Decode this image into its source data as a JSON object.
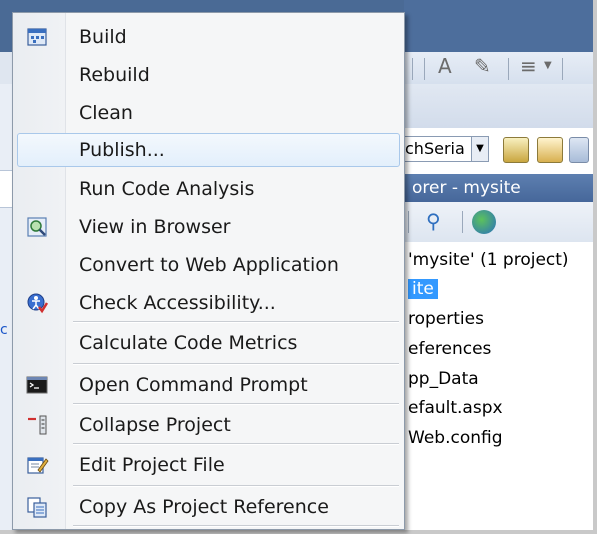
{
  "menu": {
    "items": [
      {
        "label": "Build",
        "icon": "build-icon"
      },
      {
        "label": "Rebuild",
        "icon": ""
      },
      {
        "label": "Clean",
        "icon": ""
      },
      {
        "label": "Publish...",
        "icon": "",
        "highlighted": true
      },
      {
        "label": "Run Code Analysis",
        "icon": ""
      },
      {
        "label": "View in Browser",
        "icon": "view-in-browser-icon"
      },
      {
        "label": "Convert to Web Application",
        "icon": ""
      },
      {
        "label": "Check Accessibility...",
        "icon": "accessibility-icon"
      },
      {
        "label": "Calculate Code Metrics",
        "icon": ""
      },
      {
        "label": "Open Command Prompt",
        "icon": "command-prompt-icon"
      },
      {
        "label": "Collapse Project",
        "icon": "collapse-project-icon"
      },
      {
        "label": "Edit Project File",
        "icon": "edit-project-icon"
      },
      {
        "label": "Copy As Project Reference",
        "icon": "copy-reference-icon"
      }
    ]
  },
  "toolbar": {
    "combo_value": "chSeria"
  },
  "solution_explorer": {
    "title": "orer - mysite",
    "tree": [
      {
        "label": "'mysite' (1 project)"
      },
      {
        "label": "ite",
        "selected": true
      },
      {
        "label": "roperties"
      },
      {
        "label": "eferences"
      },
      {
        "label": "pp_Data"
      },
      {
        "label": "efault.aspx"
      },
      {
        "label": "Web.config"
      }
    ]
  },
  "colors": {
    "title_bar": "#4a6a95",
    "selection": "#3399ff",
    "menu_highlight_border": "#a9c8ea",
    "menu_background": "#f5f6f7"
  }
}
